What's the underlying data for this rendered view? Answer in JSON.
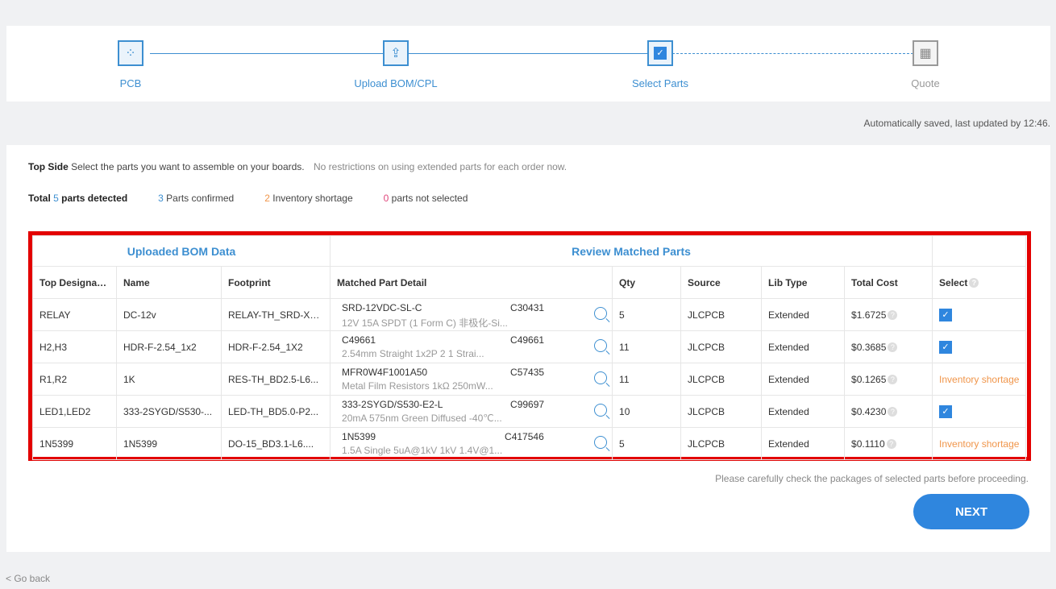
{
  "steps": [
    {
      "label": "PCB",
      "icon": "pcb-icon",
      "state": "done"
    },
    {
      "label": "Upload BOM/CPL",
      "icon": "upload-icon",
      "state": "done"
    },
    {
      "label": "Select Parts",
      "icon": "chip-check-icon",
      "state": "current"
    },
    {
      "label": "Quote",
      "icon": "calculator-icon",
      "state": "todo"
    }
  ],
  "saved_text": "Automatically saved, last updated by 12:46.",
  "intro": {
    "side": "Top Side",
    "instruction": "Select the parts you want to assemble on your boards.",
    "notice": "No restrictions on using extended parts for each order now."
  },
  "stats": {
    "total_prefix": "Total ",
    "total": "5",
    "total_suffix": " parts detected",
    "confirmed": "3",
    "confirmed_label": " Parts confirmed",
    "shortage": "2",
    "shortage_label": " Inventory shortage",
    "not_selected": "0",
    "not_selected_label": " parts not selected"
  },
  "colors": {
    "accent": "#3d8fd1",
    "shortage": "#f0954a",
    "not_selected": "#e0457b",
    "highlight": "#e30000"
  },
  "table": {
    "group_headers": [
      "Uploaded BOM Data",
      "Review Matched Parts"
    ],
    "columns": [
      "Top Designator",
      "Name",
      "Footprint",
      "Matched Part Detail",
      "Qty",
      "Source",
      "Lib Type",
      "Total Cost",
      "Select"
    ],
    "rows": [
      {
        "designator": "RELAY",
        "name": "DC-12v",
        "footprint": "RELAY-TH_SRD-XX...",
        "part": "SRD-12VDC-SL-C",
        "code": "C30431",
        "desc": "12V 15A SPDT (1 Form C) 非极化-Si...",
        "qty": "5",
        "source": "JLCPCB",
        "lib": "Extended",
        "cost": "$1.6725",
        "selected": true,
        "status": ""
      },
      {
        "designator": "H2,H3",
        "name": "HDR-F-2.54_1x2",
        "footprint": "HDR-F-2.54_1X2",
        "part": "C49661",
        "code": "C49661",
        "desc": "2.54mm Straight 1x2P 2 1 Strai...",
        "qty": "11",
        "source": "JLCPCB",
        "lib": "Extended",
        "cost": "$0.3685",
        "selected": true,
        "status": ""
      },
      {
        "designator": "R1,R2",
        "name": "1K",
        "footprint": "RES-TH_BD2.5-L6...",
        "part": "MFR0W4F1001A50",
        "code": "C57435",
        "desc": "Metal Film Resistors 1kΩ 250mW...",
        "qty": "11",
        "source": "JLCPCB",
        "lib": "Extended",
        "cost": "$0.1265",
        "selected": false,
        "status": "Inventory shortage"
      },
      {
        "designator": "LED1,LED2",
        "name": "333-2SYGD/S530-...",
        "footprint": "LED-TH_BD5.0-P2...",
        "part": "333-2SYGD/S530-E2-L",
        "code": "C99697",
        "desc": "20mA 575nm Green Diffused -40℃...",
        "qty": "10",
        "source": "JLCPCB",
        "lib": "Extended",
        "cost": "$0.4230",
        "selected": true,
        "status": ""
      },
      {
        "designator": "1N5399",
        "name": "1N5399",
        "footprint": "DO-15_BD3.1-L6....",
        "part": "1N5399",
        "code": "C417546",
        "desc": "1.5A Single 5uA@1kV 1kV 1.4V@1...",
        "qty": "5",
        "source": "JLCPCB",
        "lib": "Extended",
        "cost": "$0.1110",
        "selected": false,
        "status": "Inventory shortage"
      }
    ]
  },
  "note": "Please carefully check the packages of selected parts before proceeding.",
  "next_label": "NEXT",
  "back_label": "< Go back"
}
